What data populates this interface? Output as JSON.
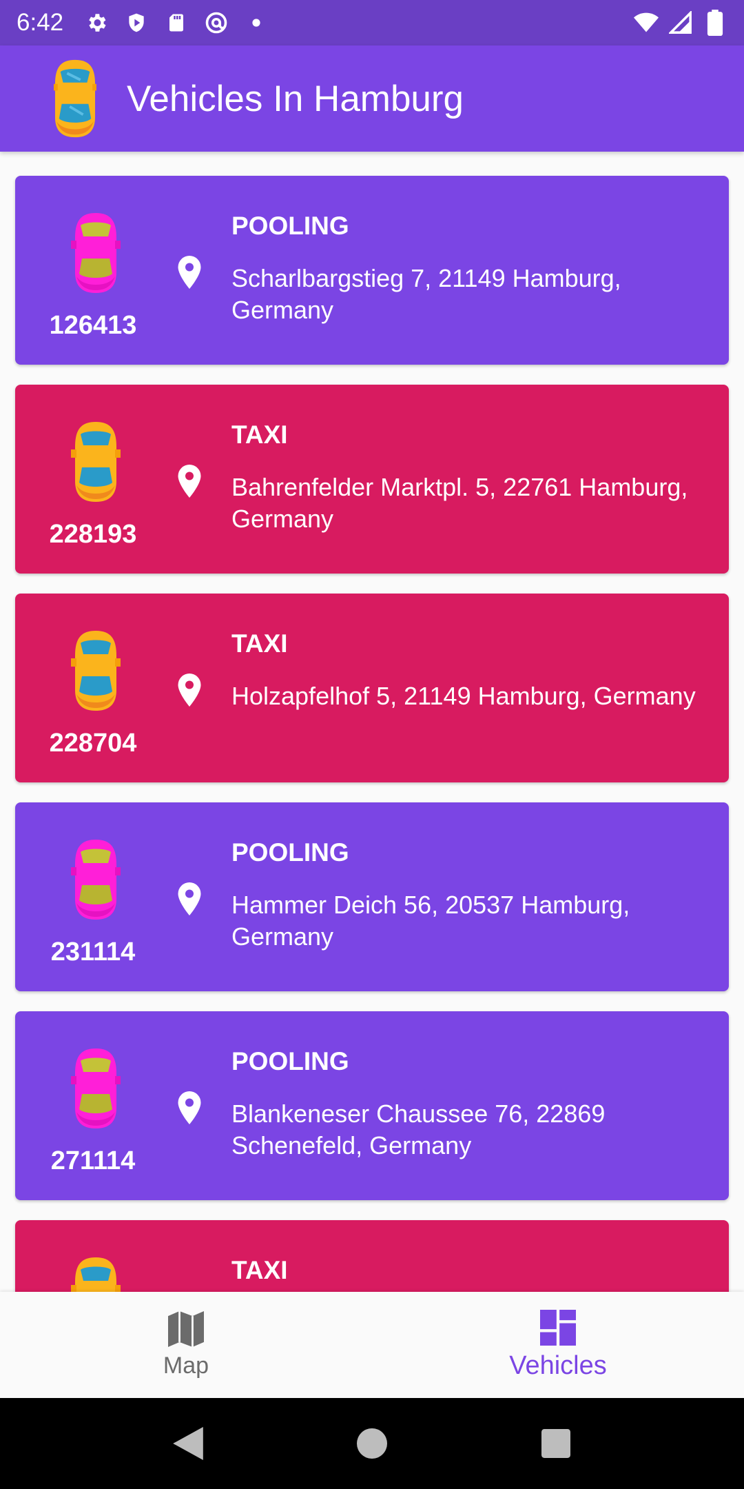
{
  "status_bar": {
    "time": "6:42",
    "icons": [
      "gear-icon",
      "shield-icon",
      "sd-card-icon",
      "at-sign-icon",
      "dot-icon",
      "wifi-icon",
      "signal-icon",
      "battery-icon"
    ]
  },
  "app_bar": {
    "title": "Vehicles In Hamburg",
    "logo": "taxi-car-icon"
  },
  "colors": {
    "status_bar": "#6a3fc4",
    "app_bar": "#7b45e4",
    "pooling_card": "#7b45e4",
    "taxi_card": "#d81b60",
    "taxi_car": "#fbb41c",
    "pooling_car": "#ff1fd8"
  },
  "vehicles": [
    {
      "id": "126413",
      "type": "POOLING",
      "address": "Scharlbargstieg 7, 21149 Hamburg, Germany"
    },
    {
      "id": "228193",
      "type": "TAXI",
      "address": "Bahrenfelder Marktpl. 5, 22761 Hamburg, Germany"
    },
    {
      "id": "228704",
      "type": "TAXI",
      "address": "Holzapfelhof 5, 21149 Hamburg, Germany"
    },
    {
      "id": "231114",
      "type": "POOLING",
      "address": "Hammer Deich 56, 20537 Hamburg, Germany"
    },
    {
      "id": "271114",
      "type": "POOLING",
      "address": "Blankeneser Chaussee 76, 22869 Schenefeld, Germany"
    },
    {
      "id": "",
      "type": "TAXI",
      "address": ""
    }
  ],
  "bottom_nav": {
    "map_label": "Map",
    "vehicles_label": "Vehicles",
    "selected": "Vehicles"
  },
  "system_nav": [
    "back-icon",
    "home-icon",
    "recents-icon"
  ]
}
